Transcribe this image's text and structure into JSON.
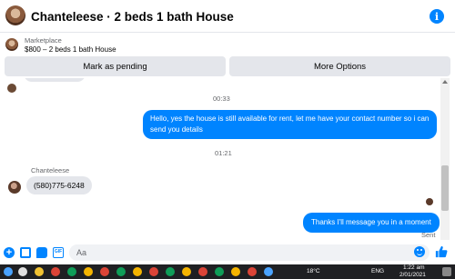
{
  "header": {
    "title": "Chanteleese · 2 beds 1 bath House",
    "info_glyph": "i"
  },
  "marketplace": {
    "label": "Marketplace",
    "item": "$800 – 2 beds 1 bath House"
  },
  "actions": {
    "mark_pending": "Mark as pending",
    "more_options": "More Options"
  },
  "chat": {
    "time_1": "00:33",
    "outgoing_1": "Hello, yes the house is still available for rent, let me have your contact number so i can send you details",
    "time_2": "01:21",
    "sender_name": "Chanteleese",
    "incoming_1": "(580)775-6248",
    "outgoing_2": "Thanks I'll message you in a moment",
    "status": "Sent"
  },
  "composer": {
    "placeholder": "Aa",
    "plus_glyph": "+",
    "gif_label": "GIF"
  },
  "taskbar": {
    "weather": "18°C",
    "language": "ENG",
    "time": "1:22 am",
    "date": "2/01/2021"
  },
  "colors": {
    "accent": "#0084ff",
    "button_bg": "#e4e6eb",
    "taskbar_bg": "#1f2023"
  }
}
